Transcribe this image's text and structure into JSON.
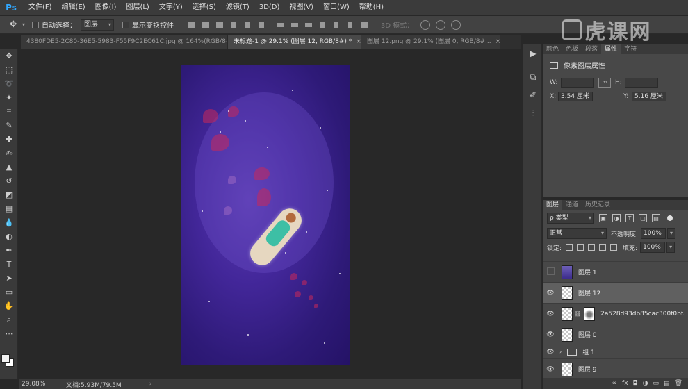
{
  "menu": {
    "logo": "Ps",
    "items": [
      "文件(F)",
      "编辑(E)",
      "图像(I)",
      "图层(L)",
      "文字(Y)",
      "选择(S)",
      "滤镜(T)",
      "3D(D)",
      "视图(V)",
      "窗口(W)",
      "帮助(H)"
    ]
  },
  "options": {
    "auto_select_label": "自动选择：",
    "auto_select_value": "图层",
    "show_transform_label": "显示变换控件",
    "mode_3d_label": "3D 模式："
  },
  "watermark": {
    "text": "虎课网"
  },
  "tabs": [
    {
      "label": "4380FDE5-2C80-36E5-5983-F55F9C2EC61C.jpg @ 164%(RGB/8#..."
    },
    {
      "label": "未标题-1 @ 29.1% (图层 12, RGB/8#) *",
      "active": true
    },
    {
      "label": "图层 12.png @ 29.1% (图层 0, RGB/8#..."
    }
  ],
  "status": {
    "zoom": "29.08%",
    "doc_info": "文档:5.93M/79.5M",
    "arrow": "›"
  },
  "properties": {
    "tabs": [
      "颜色",
      "色板",
      "段落",
      "属性",
      "字符"
    ],
    "active_tab": "属性",
    "title": "像素图层属性",
    "w_label": "W:",
    "h_label": "H:",
    "x_label": "X:",
    "x_value": "3.54 厘米",
    "y_label": "Y:",
    "y_value": "5.16 厘米",
    "link_glyph": "∞"
  },
  "layers": {
    "tabs": [
      "图层",
      "通道",
      "历史记录"
    ],
    "filter_value": "ρ 类型",
    "blend_value": "正常",
    "opacity_label": "不透明度:",
    "opacity_value": "100%",
    "lock_label": "锁定:",
    "fill_label": "填充:",
    "fill_value": "100%",
    "items": [
      {
        "name": "图层 1",
        "visible": false,
        "kind": "art"
      },
      {
        "name": "图层 12",
        "visible": true,
        "kind": "blank",
        "selected": true
      },
      {
        "name": "2a528d93db85cac300f0bf...",
        "visible": true,
        "kind": "masked"
      },
      {
        "name": "图层 0",
        "visible": true,
        "kind": "blank"
      },
      {
        "name": "组 1",
        "visible": true,
        "kind": "group"
      },
      {
        "name": "图层 9",
        "visible": true,
        "kind": "blank"
      }
    ],
    "footer": [
      "∞",
      "fx",
      "◘",
      "◑",
      "▭",
      "▤",
      "🗑"
    ]
  }
}
